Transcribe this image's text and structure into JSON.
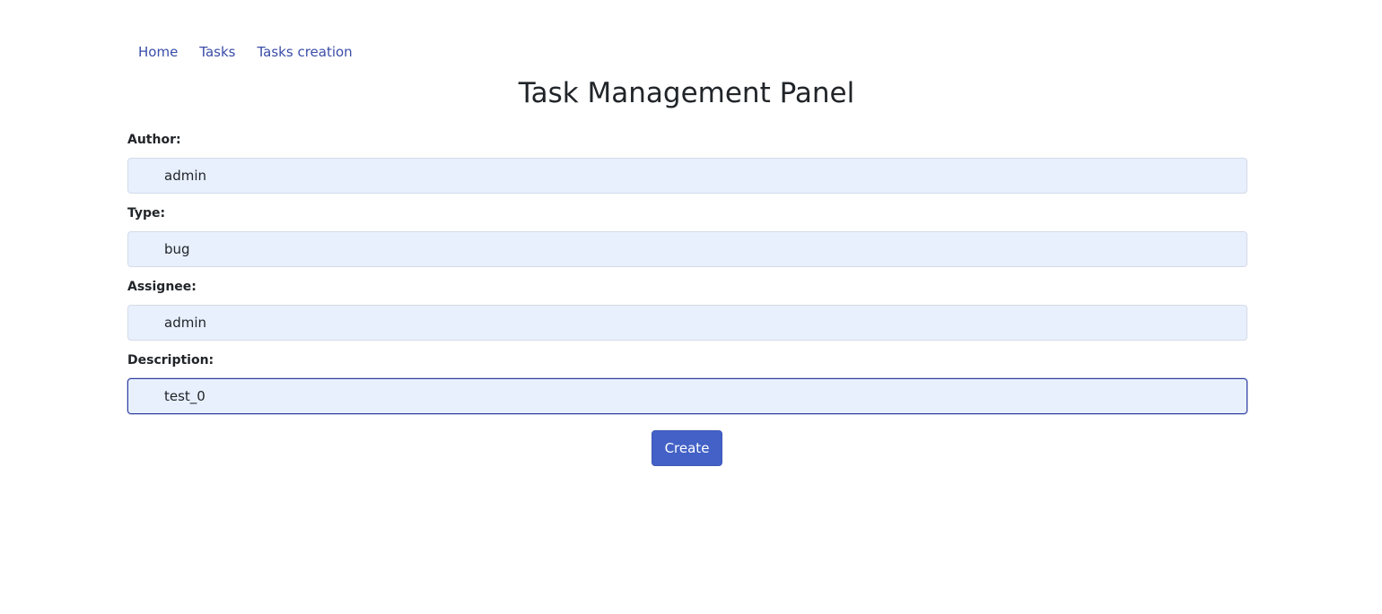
{
  "nav": {
    "items": [
      {
        "label": "Home"
      },
      {
        "label": "Tasks"
      },
      {
        "label": "Tasks creation"
      }
    ]
  },
  "page": {
    "title": "Task Management Panel"
  },
  "form": {
    "author": {
      "label": "Author:",
      "value": "admin"
    },
    "type": {
      "label": "Type:",
      "value": "bug"
    },
    "assignee": {
      "label": "Assignee:",
      "value": "admin"
    },
    "description": {
      "label": "Description:",
      "value": "test_0"
    },
    "submit_label": "Create"
  },
  "colors": {
    "accent": "#4361c6",
    "link": "#3a4da8",
    "input_bg": "#e8f0fe",
    "focus_border": "#2f3ea0"
  }
}
